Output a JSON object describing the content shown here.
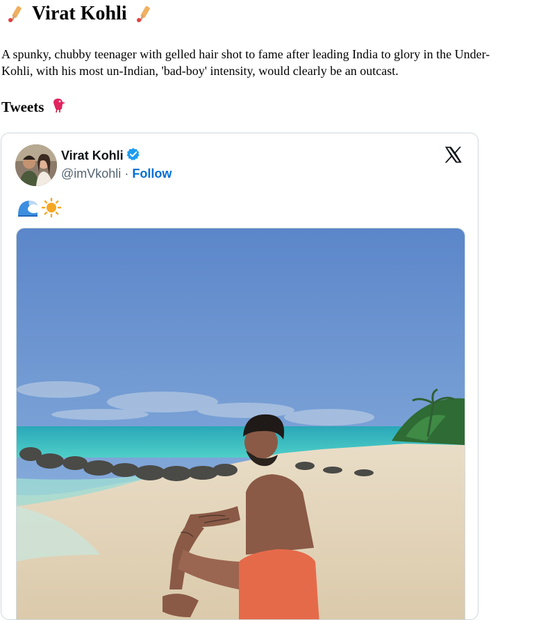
{
  "page": {
    "title": "Virat Kohli",
    "bio_lines": [
      "A spunky, chubby teenager with gelled hair shot to fame after leading India to glory in the Under-",
      "Kohli, with his most un-Indian, 'bad-boy' intensity, would clearly be an outcast."
    ],
    "tweets_heading": "Tweets"
  },
  "icons": {
    "title_left": "cricket-bat-icon",
    "title_right": "cricket-bat-icon",
    "tweets_heading": "bird-icon",
    "verified": "verified-badge-icon",
    "brand": "x-logo-icon",
    "tweet_emojis": [
      "water-wave-icon",
      "sun-icon"
    ]
  },
  "tweet": {
    "author_name": "Virat Kohli",
    "author_handle": "@imVkohli",
    "separator": "·",
    "follow_label": "Follow",
    "photo_alt": "Man sitting on a sandy beach facing the turquoise sea"
  },
  "colors": {
    "link": "#006fd6",
    "verified": "#1d9bf0",
    "card_border": "#cfd9de",
    "handle": "#536471"
  }
}
